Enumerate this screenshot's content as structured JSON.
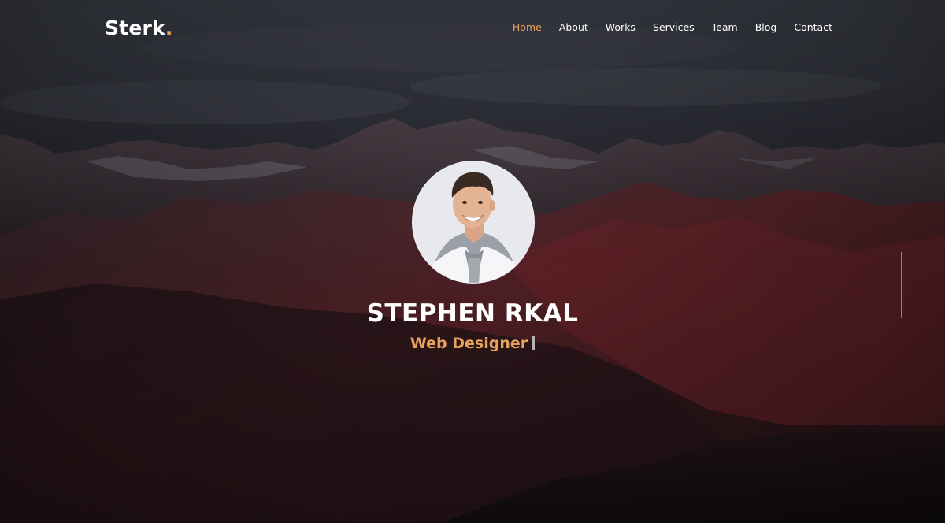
{
  "brand": {
    "name": "Sterk",
    "dot": "."
  },
  "nav": {
    "items": [
      {
        "label": "Home",
        "active": true
      },
      {
        "label": "About",
        "active": false
      },
      {
        "label": "Works",
        "active": false
      },
      {
        "label": "Services",
        "active": false
      },
      {
        "label": "Team",
        "active": false
      },
      {
        "label": "Blog",
        "active": false
      },
      {
        "label": "Contact",
        "active": false
      }
    ]
  },
  "hero": {
    "name": "STEPHEN RKAL",
    "role": "Web Designer"
  },
  "colors": {
    "accent": "#e8a15c",
    "text": "#ffffff"
  }
}
